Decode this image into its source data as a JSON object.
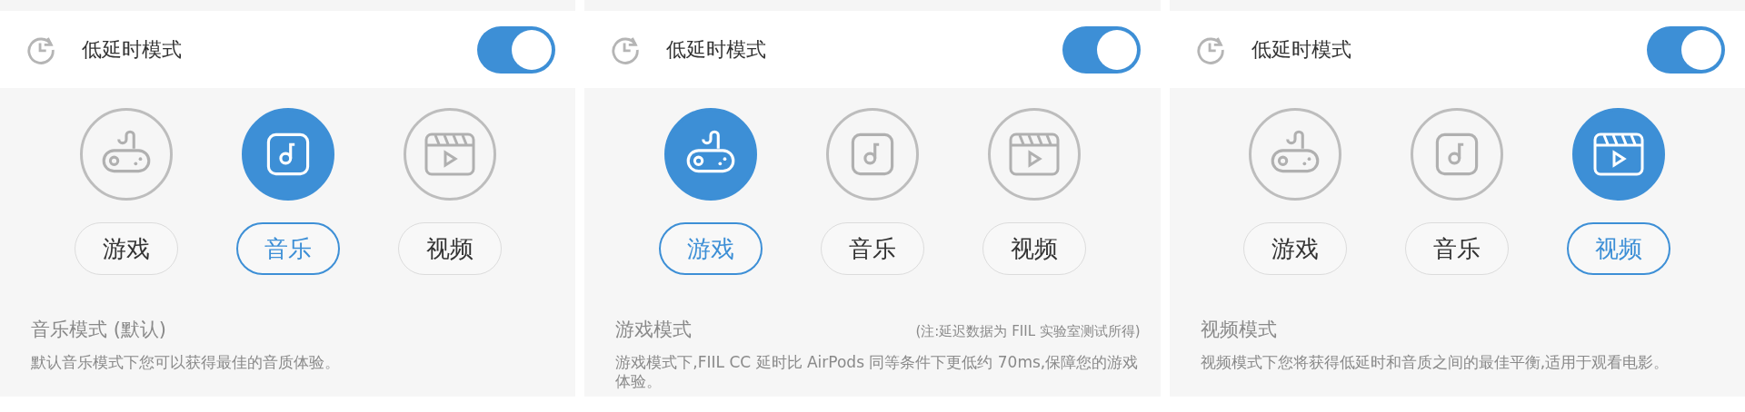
{
  "panels": [
    {
      "header": {
        "title": "低延时模式",
        "on": true
      },
      "modes": [
        {
          "kind": "game",
          "label": "游戏",
          "selected": false
        },
        {
          "kind": "music",
          "label": "音乐",
          "selected": true
        },
        {
          "kind": "video",
          "label": "视频",
          "selected": false
        }
      ],
      "mode_title": "音乐模式 (默认)",
      "description": "默认音乐模式下您可以获得最佳的音质体验。"
    },
    {
      "header": {
        "title": "低延时模式",
        "on": true
      },
      "modes": [
        {
          "kind": "game",
          "label": "游戏",
          "selected": true
        },
        {
          "kind": "music",
          "label": "音乐",
          "selected": false
        },
        {
          "kind": "video",
          "label": "视频",
          "selected": false
        }
      ],
      "mode_title": "游戏模式",
      "note": "(注:延迟数据为 FIIL 实验室测试所得)",
      "description": "游戏模式下,FIIL CC 延时比 AirPods 同等条件下更低约 70ms,保障您的游戏体验。"
    },
    {
      "header": {
        "title": "低延时模式",
        "on": true
      },
      "modes": [
        {
          "kind": "game",
          "label": "游戏",
          "selected": false
        },
        {
          "kind": "music",
          "label": "音乐",
          "selected": false
        },
        {
          "kind": "video",
          "label": "视频",
          "selected": true
        }
      ],
      "mode_title": "视频模式",
      "description": "视频模式下您将获得低延时和音质之间的最佳平衡,适用于观看电影。"
    }
  ]
}
